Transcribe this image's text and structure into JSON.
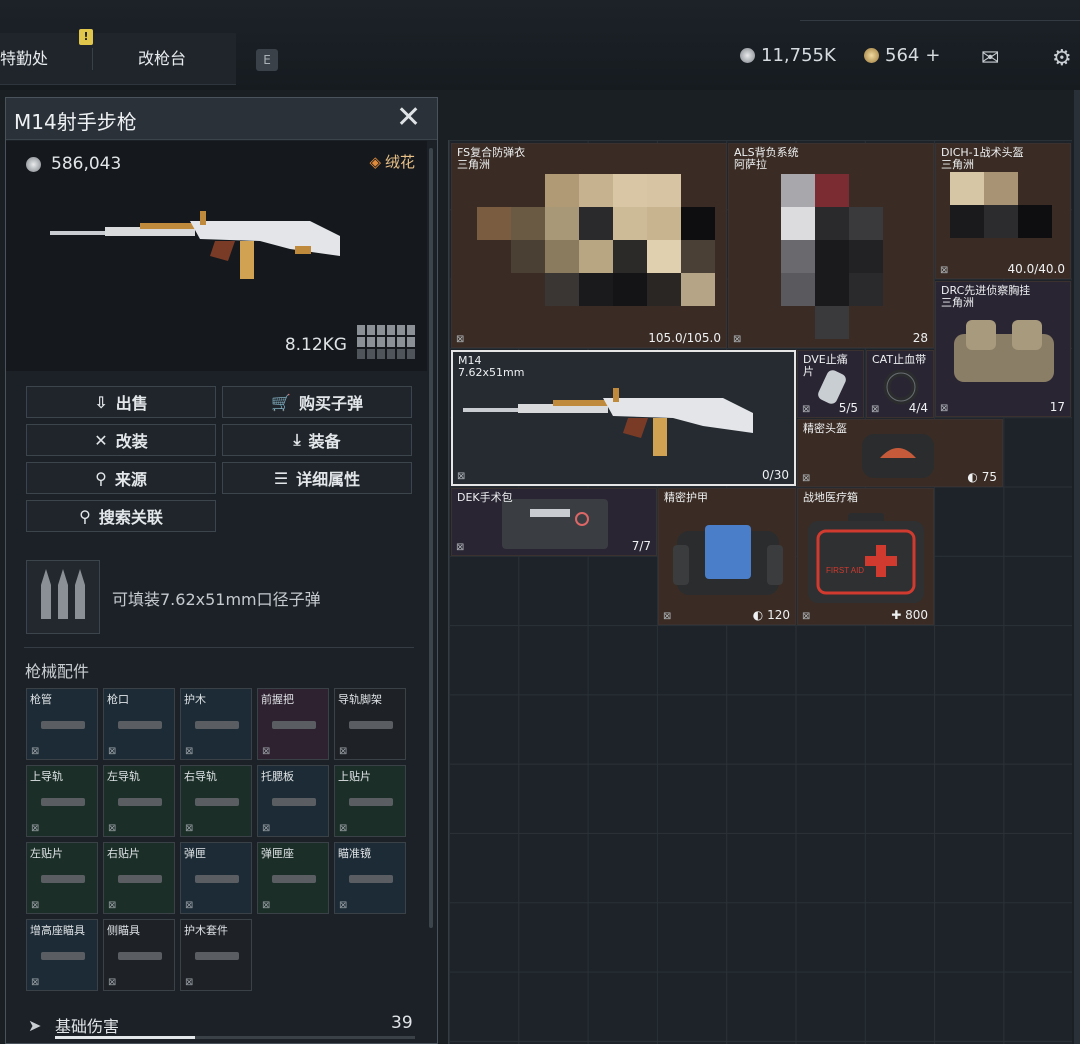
{
  "tabs": {
    "left": "特勤处",
    "right": "改枪台",
    "alert": "!",
    "key": "E"
  },
  "currency": {
    "silver": "11,755K",
    "gold": "564",
    "plus": "+"
  },
  "panel": {
    "title": "M14射手步枪",
    "price": "586,043",
    "skin": "绒花",
    "weight": "8.12KG",
    "buttons": {
      "sell": "出售",
      "buy_ammo": "购买子弹",
      "modify": "改装",
      "equip": "装备",
      "source": "来源",
      "details": "详细属性",
      "search": "搜索关联"
    },
    "ammo_text": "可填装7.62x51mm口径子弹",
    "section": "枪械配件",
    "attachments": [
      "枪管",
      "枪口",
      "护木",
      "前握把",
      "导轨脚架",
      "上导轨",
      "左导轨",
      "右导轨",
      "托腮板",
      "上贴片",
      "左贴片",
      "右贴片",
      "弹匣",
      "弹匣座",
      "瞄准镜",
      "增高座瞄具",
      "侧瞄具",
      "护木套件"
    ],
    "damage_label": "基础伤害",
    "damage_value": "39",
    "damage_fraction": 0.39
  },
  "inventory": {
    "fs": {
      "name": "FS复合防弹衣",
      "sub": "三角洲",
      "count": "105.0/105.0"
    },
    "als": {
      "name": "ALS背负系统",
      "sub": "阿萨拉",
      "count": "28"
    },
    "dich": {
      "name": "DICH-1战术头盔",
      "sub": "三角洲",
      "count": "40.0/40.0"
    },
    "drc": {
      "name": "DRC先进侦察胸挂",
      "sub": "三角洲",
      "count": "17"
    },
    "m14": {
      "name": "M14",
      "sub": "7.62x51mm",
      "count": "0/30"
    },
    "dve": {
      "name": "DVE止痛片",
      "count": "5/5"
    },
    "cat": {
      "name": "CAT止血带",
      "count": "4/4"
    },
    "helmet": {
      "name": "精密头盔",
      "count": "75"
    },
    "dek": {
      "name": "DEK手术包",
      "count": "7/7"
    },
    "armor": {
      "name": "精密护甲",
      "count": "120"
    },
    "medkit": {
      "name": "战地医疗箱",
      "count": "800",
      "label": "FIRST AID"
    }
  },
  "colors": {
    "accent": "#e9c189",
    "panel": "#1b2127",
    "selected": "#e6e6e6"
  }
}
